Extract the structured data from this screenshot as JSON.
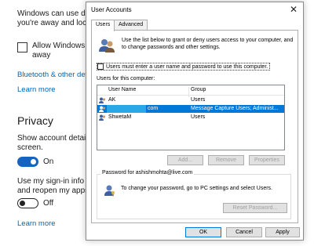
{
  "settings": {
    "line1": "Windows can use devi",
    "line2": "you're away and lock y",
    "allow_label_1": "Allow Windows to",
    "allow_label_2": "away",
    "link_bluetooth": "Bluetooth & other dev",
    "link_learn_more_1": "Learn more",
    "privacy_heading": "Privacy",
    "show_details_1": "Show account details s",
    "show_details_2": "screen.",
    "toggle1_state": "On",
    "signin_1": "Use my sign-in info to",
    "signin_2": "and reopen my apps a",
    "toggle2_state": "Off",
    "link_learn_more_2": "Learn more",
    "accent_color": "#0067b8"
  },
  "dialog": {
    "title": "User Accounts",
    "tabs": [
      {
        "label": "Users",
        "active": true
      },
      {
        "label": "Advanced",
        "active": false
      }
    ],
    "intro": "Use the list below to grant or deny users access to your computer, and to change passwords and other settings.",
    "must_enter_label": "Users must enter a user name and password to use this computer.",
    "must_enter_checked": false,
    "users_label": "Users for this computer:",
    "columns": [
      "User Name",
      "Group"
    ],
    "users": [
      {
        "name": "AK",
        "group": "Users",
        "selected": false
      },
      {
        "name": "com",
        "group": "Message Capture Users; Administ...",
        "selected": true
      },
      {
        "name": "ShwetaM",
        "group": "Users",
        "selected": false
      }
    ],
    "buttons": {
      "add": "Add...",
      "remove": "Remove",
      "properties": "Properties"
    },
    "password_group_title": "Password for ashishmohta@live.com",
    "password_text": "To change your password, go to PC settings and select Users.",
    "reset_password": "Reset Password...",
    "ok": "OK",
    "cancel": "Cancel",
    "apply": "Apply",
    "selection_color": "#0078d7"
  }
}
